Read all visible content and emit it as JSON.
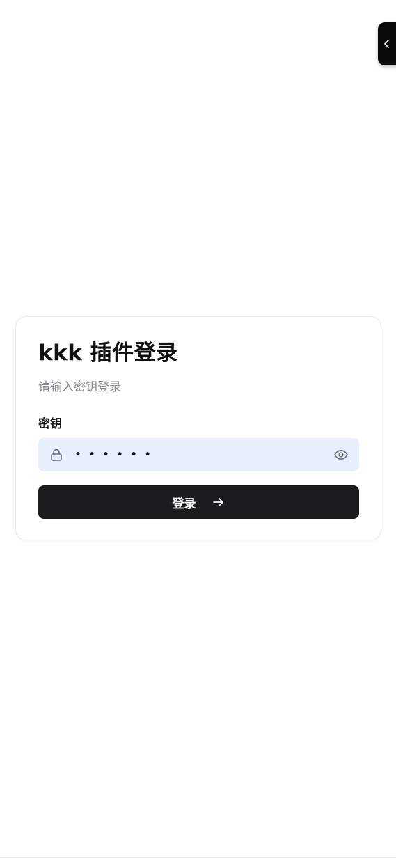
{
  "login_card": {
    "title": "kkk 插件登录",
    "subtitle": "请输入密钥登录",
    "key_field": {
      "label": "密钥",
      "value": "••••••",
      "input_type": "password",
      "background_color": "#e8effc"
    },
    "submit_button": {
      "label": "登录",
      "background_color": "#1b1b1d"
    }
  },
  "icons": {
    "side_toggle": "chevron-left-icon",
    "field_prefix": "lock-icon",
    "field_suffix": "eye-icon",
    "button_suffix": "arrow-right-icon"
  }
}
